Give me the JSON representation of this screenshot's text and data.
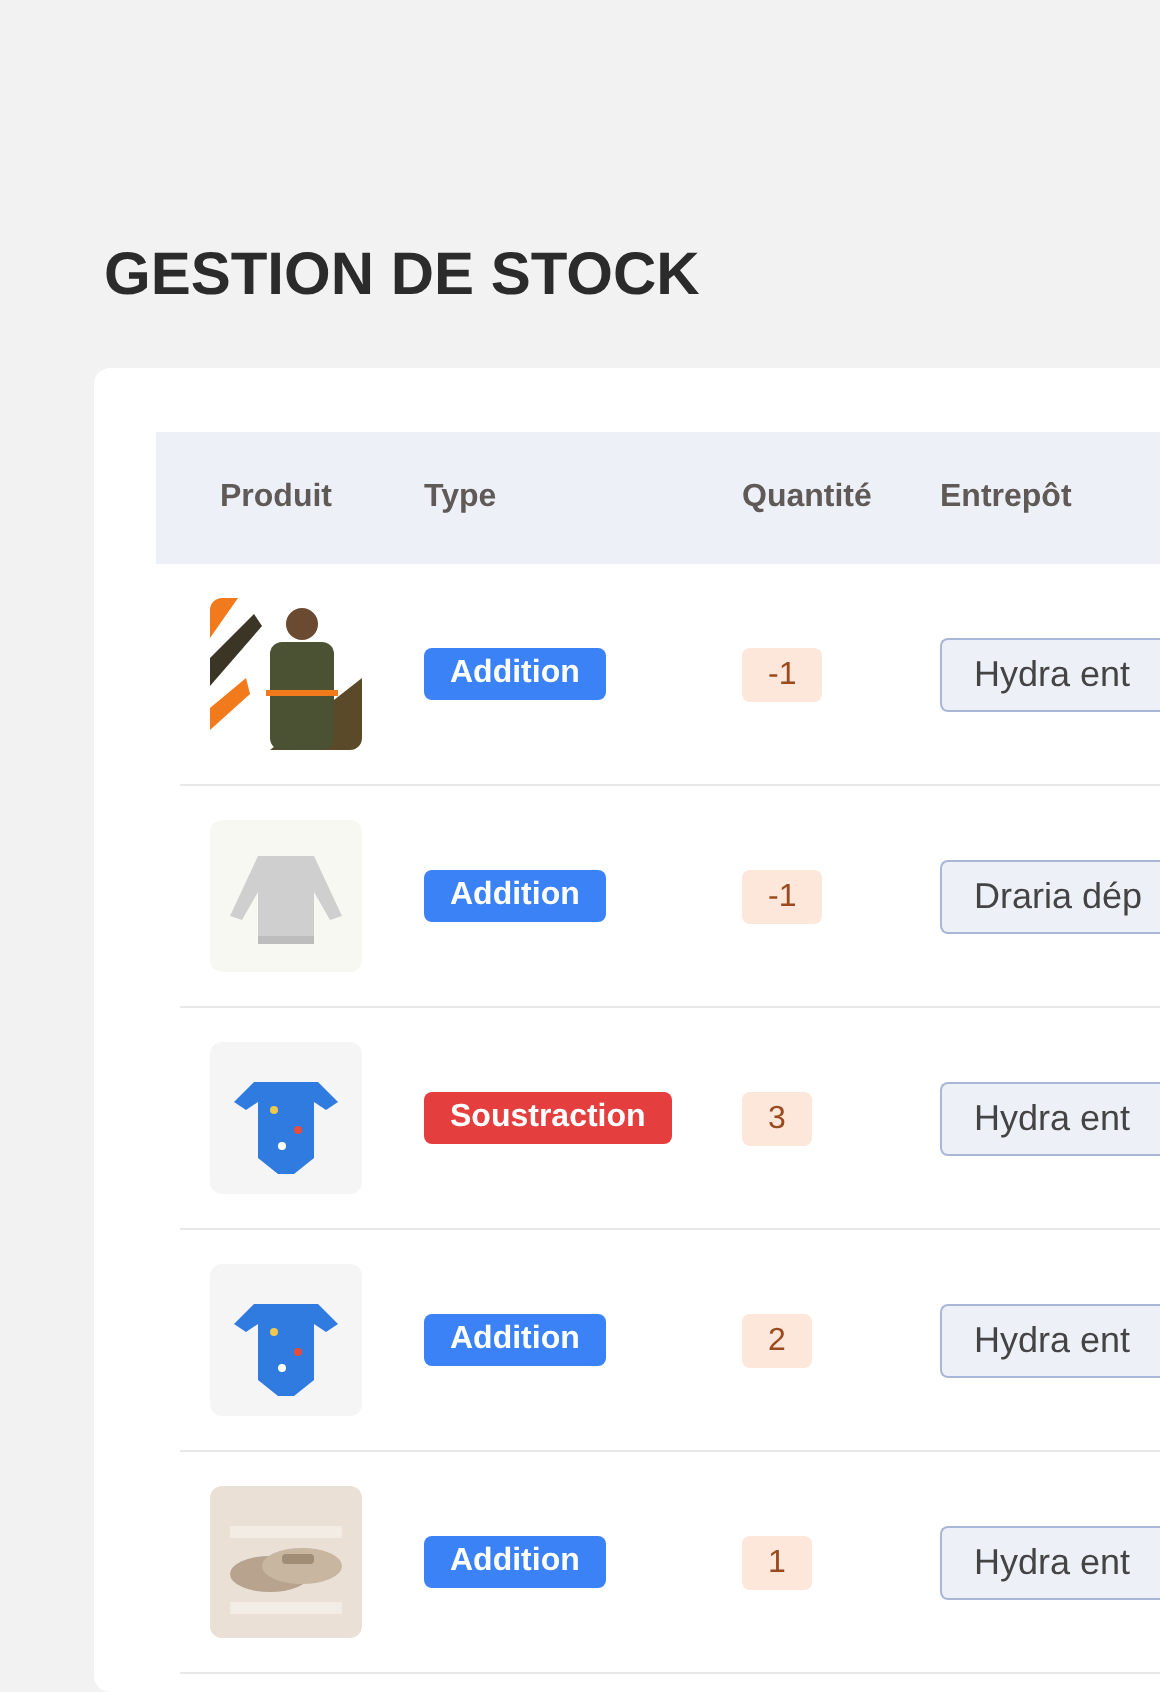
{
  "title": "GESTION DE STOCK",
  "table": {
    "columns": [
      "Produit",
      "Type",
      "Quantité",
      "Entrepôt"
    ],
    "rows": [
      {
        "type": {
          "label": "Addition",
          "kind": "addition"
        },
        "quantity": "-1",
        "warehouse": "Hydra ent"
      },
      {
        "type": {
          "label": "Addition",
          "kind": "addition"
        },
        "quantity": "-1",
        "warehouse": "Draria dép"
      },
      {
        "type": {
          "label": "Soustraction",
          "kind": "subtraction"
        },
        "quantity": "3",
        "warehouse": "Hydra ent"
      },
      {
        "type": {
          "label": "Addition",
          "kind": "addition"
        },
        "quantity": "2",
        "warehouse": "Hydra ent"
      },
      {
        "type": {
          "label": "Addition",
          "kind": "addition"
        },
        "quantity": "1",
        "warehouse": "Hydra ent"
      }
    ]
  }
}
